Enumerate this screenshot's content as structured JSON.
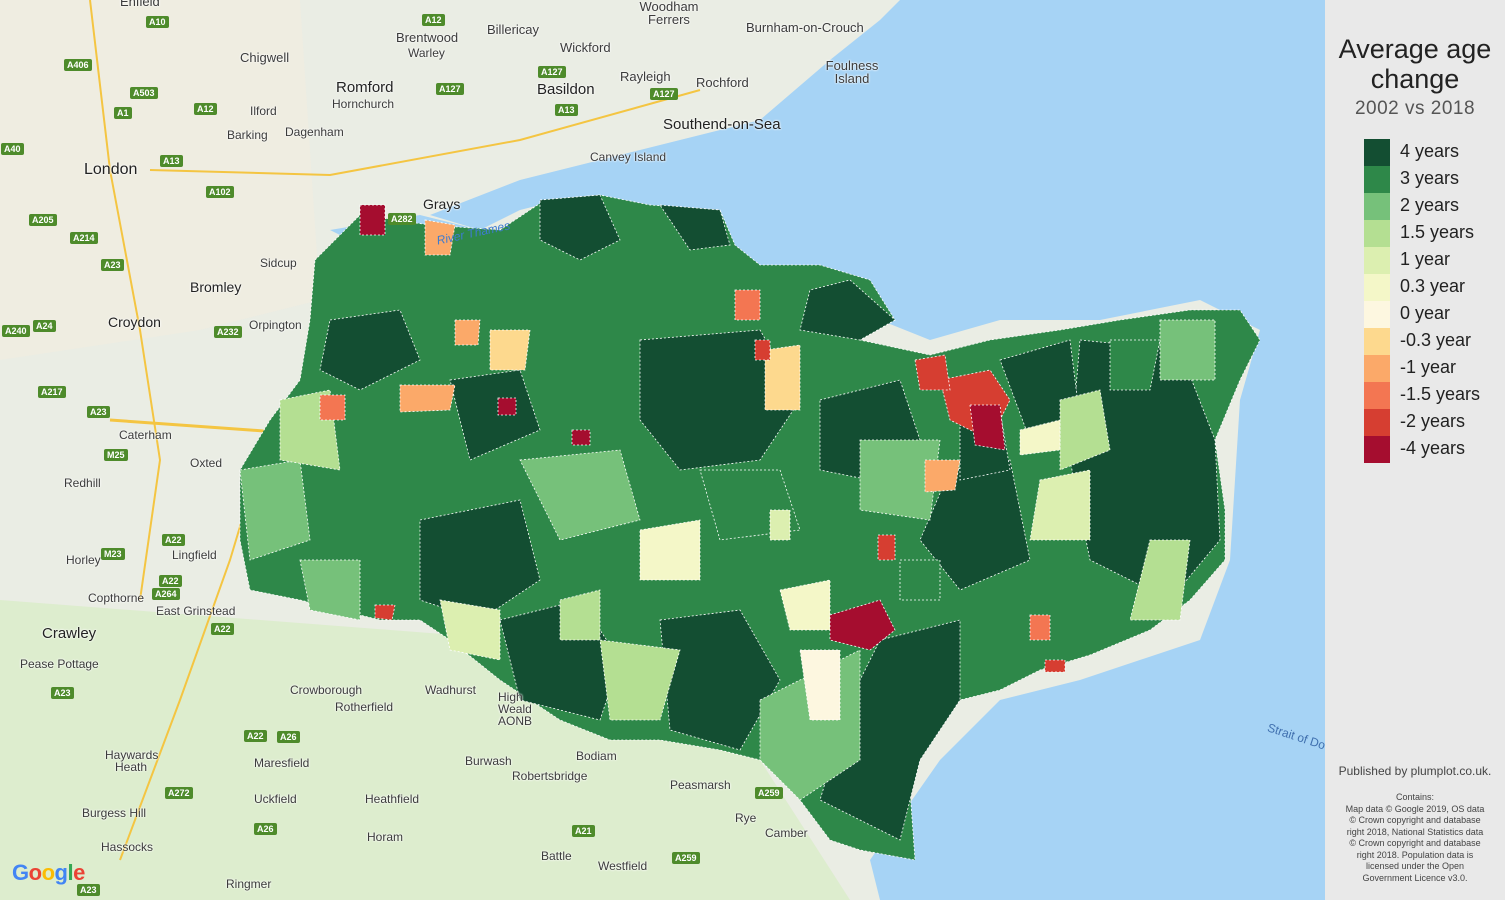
{
  "legend": {
    "title_line1": "Average age",
    "title_line2": "change",
    "subtitle": "2002 vs 2018",
    "items": [
      {
        "label": "4 years",
        "color": "#134e32"
      },
      {
        "label": "3 years",
        "color": "#2e8849"
      },
      {
        "label": "2 years",
        "color": "#76c17a"
      },
      {
        "label": "1.5 years",
        "color": "#b4df92"
      },
      {
        "label": "1 year",
        "color": "#dcefb0"
      },
      {
        "label": "0.3 year",
        "color": "#f4f7c8"
      },
      {
        "label": "0 year",
        "color": "#fdf7e0"
      },
      {
        "label": "-0.3 year",
        "color": "#fdd98e"
      },
      {
        "label": "-1 year",
        "color": "#fba969"
      },
      {
        "label": "-1.5 years",
        "color": "#f37652"
      },
      {
        "label": "-2 years",
        "color": "#d63e31"
      },
      {
        "label": "-4 years",
        "color": "#a50d2f"
      }
    ]
  },
  "credits": {
    "published": "Published by plumplot.co.uk.",
    "contains_lines": [
      "Contains:",
      "Map data © Google 2019, OS data",
      "© Crown copyright and database",
      "right 2018, National Statistics data",
      "© Crown copyright and database",
      "right 2018. Population data is",
      "licensed under the Open",
      "Government Licence v3.0."
    ]
  },
  "map": {
    "google_logo": "Google",
    "places": [
      {
        "name": "Enfield"
      },
      {
        "name": "Chigwell"
      },
      {
        "name": "Brentwood"
      },
      {
        "name": "Warley"
      },
      {
        "name": "Billericay"
      },
      {
        "name": "Woodham Ferrers"
      },
      {
        "name": "Burnham-on-Crouch"
      },
      {
        "name": "Wickford"
      },
      {
        "name": "Rayleigh"
      },
      {
        "name": "Rochford"
      },
      {
        "name": "Foulness Island"
      },
      {
        "name": "Romford"
      },
      {
        "name": "Hornchurch"
      },
      {
        "name": "Basildon"
      },
      {
        "name": "Southend-on-Sea"
      },
      {
        "name": "Ilford"
      },
      {
        "name": "Barking"
      },
      {
        "name": "Dagenham"
      },
      {
        "name": "Canvey Island"
      },
      {
        "name": "London"
      },
      {
        "name": "Grays"
      },
      {
        "name": "River Thames"
      },
      {
        "name": "Sidcup"
      },
      {
        "name": "Bromley"
      },
      {
        "name": "Croydon"
      },
      {
        "name": "Orpington"
      },
      {
        "name": "Caterham"
      },
      {
        "name": "Oxted"
      },
      {
        "name": "Redhill"
      },
      {
        "name": "Horley"
      },
      {
        "name": "Lingfield"
      },
      {
        "name": "Copthorne"
      },
      {
        "name": "East Grinstead"
      },
      {
        "name": "Crawley"
      },
      {
        "name": "Pease Pottage"
      },
      {
        "name": "Crowborough"
      },
      {
        "name": "Wadhurst"
      },
      {
        "name": "Rotherfield"
      },
      {
        "name": "High Weald AONB"
      },
      {
        "name": "Haywards Heath"
      },
      {
        "name": "Maresfield"
      },
      {
        "name": "Uckfield"
      },
      {
        "name": "Burgess Hill"
      },
      {
        "name": "Heathfield"
      },
      {
        "name": "Burwash"
      },
      {
        "name": "Robertsbridge"
      },
      {
        "name": "Bodiam"
      },
      {
        "name": "Peasmarsh"
      },
      {
        "name": "Rye"
      },
      {
        "name": "Camber"
      },
      {
        "name": "Hassocks"
      },
      {
        "name": "Horam"
      },
      {
        "name": "Battle"
      },
      {
        "name": "Westfield"
      },
      {
        "name": "Ringmer"
      },
      {
        "name": "Strait of Dover"
      }
    ],
    "roads": [
      "A10",
      "A12",
      "A406",
      "A503",
      "A1",
      "A12",
      "A127",
      "A127",
      "A13",
      "A127",
      "A13",
      "A102",
      "A40",
      "A205",
      "A214",
      "A23",
      "A24",
      "A232",
      "A240",
      "A217",
      "A23",
      "M25",
      "A22",
      "M23",
      "A22",
      "A264",
      "A22",
      "A23",
      "A22",
      "A26",
      "A272",
      "A26",
      "A21",
      "A259",
      "A259",
      "A23",
      "A282"
    ]
  }
}
